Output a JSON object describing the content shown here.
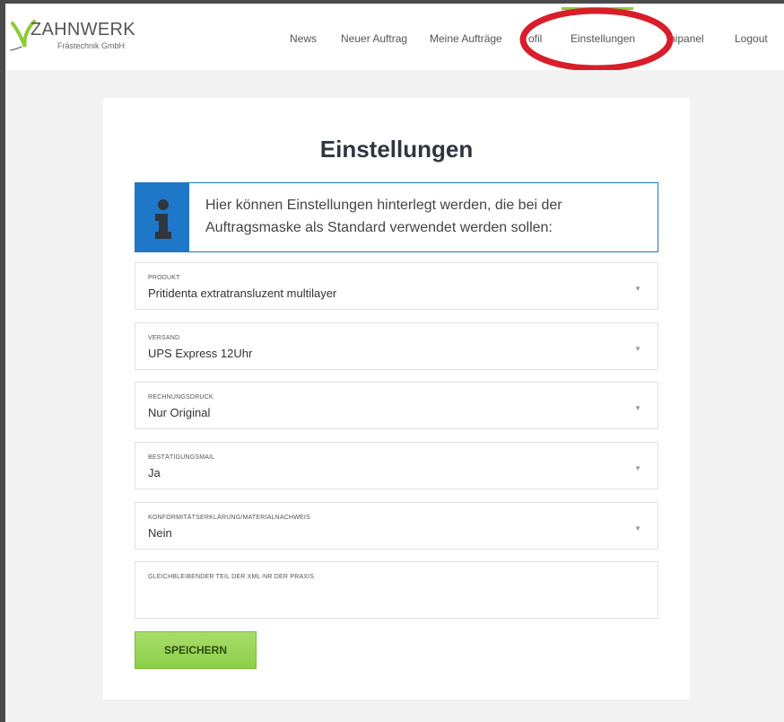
{
  "brand": {
    "title": "ZAHNWERK",
    "subtitle": "Frästechnik GmbH",
    "accent_color": "#8fca3a"
  },
  "nav": {
    "items": [
      {
        "label": "News"
      },
      {
        "label": "Neuer Auftrag"
      },
      {
        "label": "Meine Aufträge"
      },
      {
        "label": "ofil"
      },
      {
        "label": "Einstellungen"
      },
      {
        "label": "nipanel"
      },
      {
        "label": "Logout"
      }
    ],
    "active": "Einstellungen"
  },
  "annotation": {
    "color": "#d81e2a",
    "shape": "ellipse"
  },
  "page": {
    "title": "Einstellungen",
    "info_text": "Hier können Einstellungen hinterlegt werden, die bei der Auftragsmaske als Standard verwendet werden sollen:",
    "info_icon": "info-icon",
    "info_color": "#1f77c8"
  },
  "fields": [
    {
      "label": "PRODUKT",
      "value": "Pritidenta extratransluzent multilayer"
    },
    {
      "label": "VERSAND",
      "value": "UPS Express 12Uhr"
    },
    {
      "label": "RECHNUNGSDRUCK",
      "value": "Nur Original"
    },
    {
      "label": "BESTÄTIGUNGSMAIL",
      "value": "Ja"
    },
    {
      "label": "KONFORMITÄTSERKLÄRUNG/MATERIALNACHWEIS",
      "value": "Nein"
    }
  ],
  "textarea": {
    "label": "GLEICHBLEIBENDER TEIL DER XML-NR DER PRAXIS",
    "value": ""
  },
  "save_button": {
    "label": "SPEICHERN",
    "color": "#8ccf48"
  }
}
